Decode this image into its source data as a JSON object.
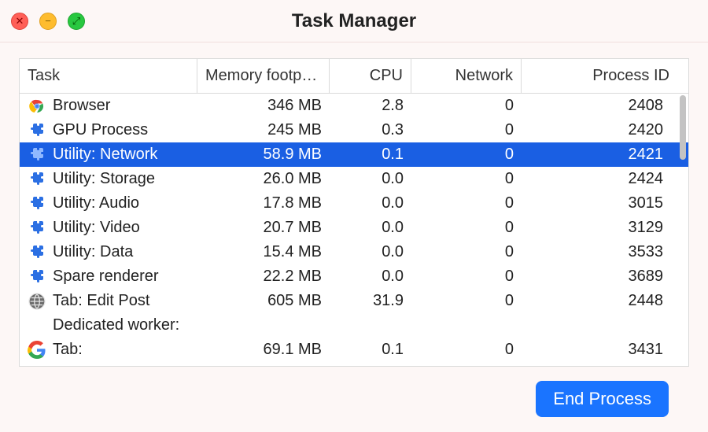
{
  "window": {
    "title": "Task Manager"
  },
  "columns": {
    "task": "Task",
    "memory": "Memory footp…",
    "cpu": "CPU",
    "network": "Network",
    "process_id": "Process ID"
  },
  "rows": [
    {
      "icon": "chrome",
      "task": "Browser",
      "memory": "346 MB",
      "cpu": "2.8",
      "network": "0",
      "pid": "2408",
      "selected": false
    },
    {
      "icon": "puzzle",
      "task": "GPU Process",
      "memory": "245 MB",
      "cpu": "0.3",
      "network": "0",
      "pid": "2420",
      "selected": false
    },
    {
      "icon": "puzzle",
      "task": "Utility: Network",
      "memory": "58.9 MB",
      "cpu": "0.1",
      "network": "0",
      "pid": "2421",
      "selected": true
    },
    {
      "icon": "puzzle",
      "task": "Utility: Storage",
      "memory": "26.0 MB",
      "cpu": "0.0",
      "network": "0",
      "pid": "2424",
      "selected": false
    },
    {
      "icon": "puzzle",
      "task": "Utility: Audio",
      "memory": "17.8 MB",
      "cpu": "0.0",
      "network": "0",
      "pid": "3015",
      "selected": false
    },
    {
      "icon": "puzzle",
      "task": "Utility: Video",
      "memory": "20.7 MB",
      "cpu": "0.0",
      "network": "0",
      "pid": "3129",
      "selected": false
    },
    {
      "icon": "puzzle",
      "task": "Utility: Data",
      "memory": "15.4 MB",
      "cpu": "0.0",
      "network": "0",
      "pid": "3533",
      "selected": false
    },
    {
      "icon": "puzzle",
      "task": "Spare renderer",
      "memory": "22.2 MB",
      "cpu": "0.0",
      "network": "0",
      "pid": "3689",
      "selected": false
    },
    {
      "icon": "globe",
      "task": "Tab: Edit Post",
      "memory": "605 MB",
      "cpu": "31.9",
      "network": "0",
      "pid": "2448",
      "selected": false
    },
    {
      "icon": "blank",
      "task": "Dedicated worker:",
      "memory": "",
      "cpu": "",
      "network": "",
      "pid": "",
      "selected": false
    },
    {
      "icon": "google",
      "task": "Tab:",
      "memory": "69.1 MB",
      "cpu": "0.1",
      "network": "0",
      "pid": "3431",
      "selected": false
    }
  ],
  "footer": {
    "end_process": "End Process"
  }
}
